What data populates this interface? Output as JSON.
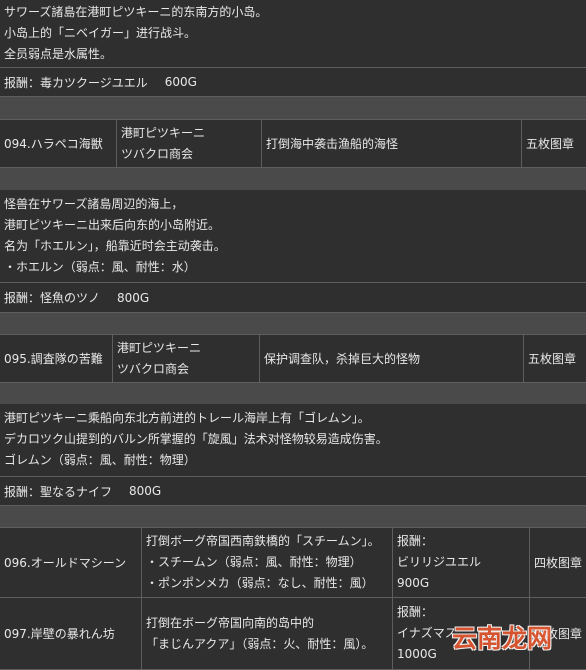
{
  "colors": {
    "background": "#2f2f2f",
    "band": "#4a4a4a",
    "line": "#5e5e5e",
    "text": "#e8e8e8",
    "watermark": "#e4572e"
  },
  "top_section": {
    "lines": [
      "サワーズ諸島在港町ピツキーニ的东南方的小岛。",
      "小岛上的「ニベイガー」进行战斗。",
      "全员弱点是水属性。"
    ],
    "reward": {
      "item": "报酬：毒カツクージユエル",
      "gold": "600G"
    }
  },
  "quests": [
    {
      "name": "094.ハラペコ海獣",
      "client": [
        "港町ピツキーニ",
        "ツバクロ商会"
      ],
      "objective": "打倒海中袭击渔船的海怪",
      "stamps": "五枚图章",
      "details": [
        "怪兽在サワーズ諸島周辺的海上，",
        "港町ピツキーニ出来后向东的小岛附近。",
        "名为「ホエルン」，船靠近时会主动袭击。",
        "・ホエルン（弱点：風、耐性：水）"
      ],
      "reward": {
        "item": "报酬：怪魚のツノ",
        "gold": "800G"
      }
    },
    {
      "name": "095.調査隊の苦難",
      "client": [
        "港町ピツキーニ",
        "ツバクロ商会"
      ],
      "objective": "保护调查队，杀掉巨大的怪物",
      "stamps": "五枚图章",
      "details": [
        "港町ピツキーニ乘船向东北方前进的トレール海岸上有「ゴレムン」。",
        "デカロツク山提到的バルン所掌握的「旋風」法术对怪物较易造成伤害。",
        "ゴレムン（弱点：風、耐性：物理）"
      ],
      "reward": {
        "item": "报酬：聖なるナイフ",
        "gold": "800G"
      }
    },
    {
      "name": "096.オールドマシーン",
      "objective_lines": [
        "打倒ボーグ帝国西南鉄橋的「スチームン」。",
        "・スチームン（弱点：風、耐性：物理）",
        "・ポンポンメカ（弱点：なし、耐性：風）"
      ],
      "reward_lines": [
        "报酬：",
        "ビリリジユエル",
        "900G"
      ],
      "stamps": "四枚图章"
    },
    {
      "name": "097.岸壁の暴れん坊",
      "objective_lines": [
        "打倒在ボーグ帝国向南的岛中的",
        "「まじんアクア」（弱点：火、耐性：風）。"
      ],
      "reward_lines": [
        "报酬：",
        "イナズマス",
        "1000G"
      ],
      "stamps": "四枚图章"
    }
  ],
  "watermark": {
    "text": "云南龙网"
  }
}
